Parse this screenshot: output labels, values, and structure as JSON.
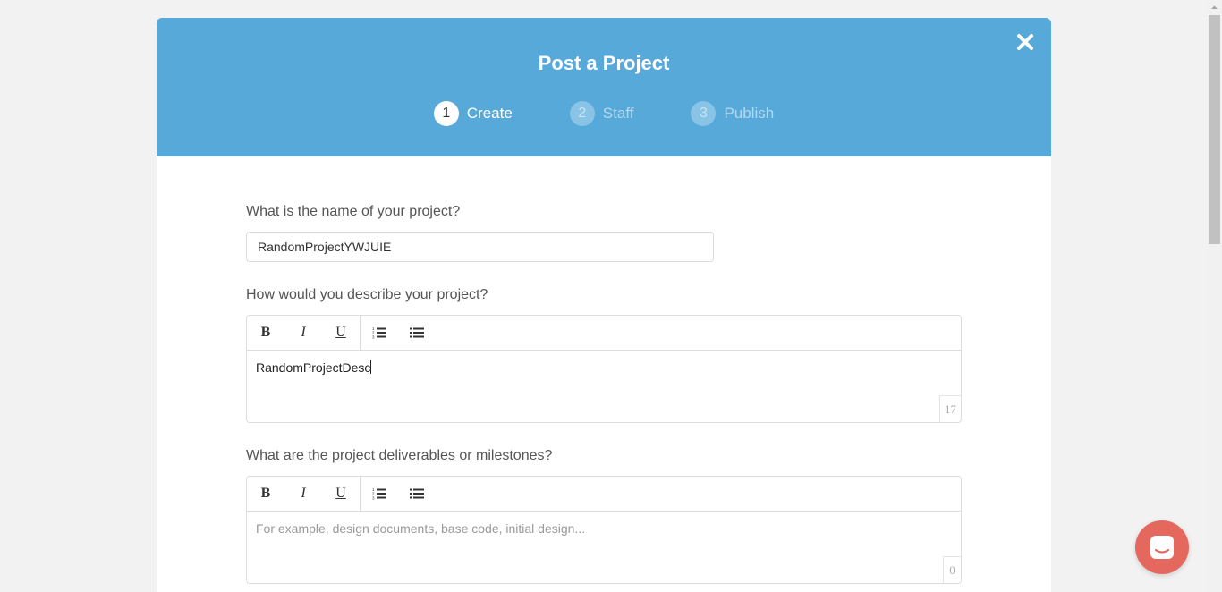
{
  "modal": {
    "title": "Post a Project",
    "close_icon": "close-icon"
  },
  "steps": [
    {
      "number": "1",
      "label": "Create",
      "state": "active"
    },
    {
      "number": "2",
      "label": "Staff",
      "state": "inactive"
    },
    {
      "number": "3",
      "label": "Publish",
      "state": "inactive"
    }
  ],
  "form": {
    "name_label": "What is the name of your project?",
    "name_value": "RandomProjectYWJUIE",
    "description_label": "How would you describe your project?",
    "description_value": "RandomProjectDesc",
    "description_count": "17",
    "deliverables_label": "What are the project deliverables or milestones?",
    "deliverables_placeholder": "For example, design documents, base code, initial design...",
    "deliverables_count": "0"
  },
  "toolbar": {
    "bold": "B",
    "italic": "I",
    "underline": "U"
  },
  "colors": {
    "header": "#57a9da",
    "chat": "#e5685f",
    "background": "#f2f2f2"
  }
}
